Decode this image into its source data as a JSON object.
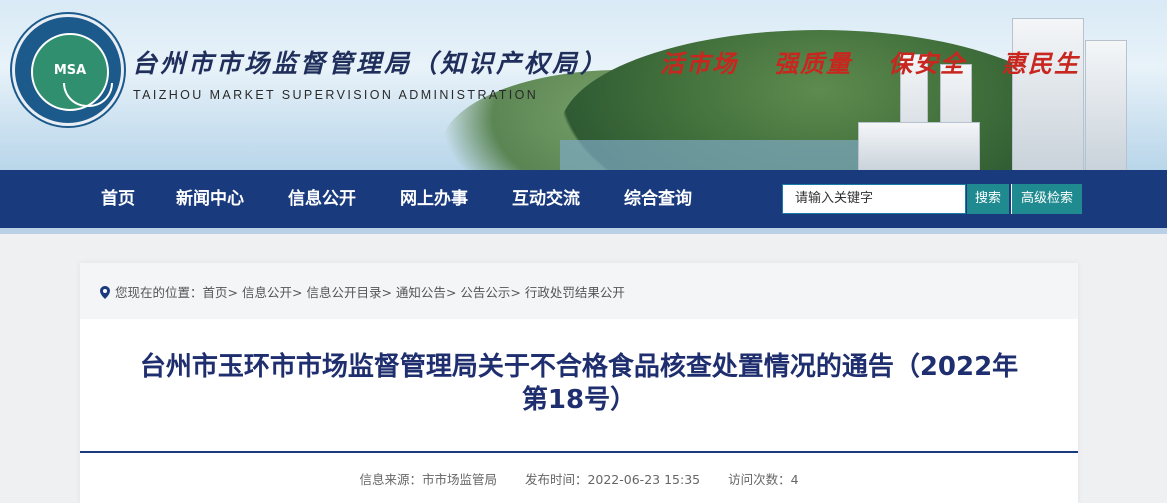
{
  "header": {
    "logo_text": "MSA",
    "logo_ring_text": "TAIZHOU MARKET SUPERVISION ADMINISTRATION",
    "title": "台州市市场监督管理局（知识产权局）",
    "subtitle": "TAIZHOU MARKET SUPERVISION ADMINISTRATION",
    "slogans": [
      "活市场",
      "强质量",
      "保安全",
      "惠民生"
    ]
  },
  "nav": {
    "items": [
      "首页",
      "新闻中心",
      "信息公开",
      "网上办事",
      "互动交流",
      "综合查询"
    ],
    "search_placeholder": "请输入关键字",
    "search_button": "搜索",
    "advanced_button": "高级检索"
  },
  "breadcrumb": {
    "prefix": "您现在的位置：",
    "path": [
      "首页",
      "信息公开",
      "信息公开目录",
      "通知公告",
      "公告公示",
      "行政处罚结果公开"
    ]
  },
  "article": {
    "title_line1": "台州市玉环市市场监督管理局关于不合格食品核查处置情况的通告（2022年",
    "title_line2": "第18号）",
    "source": "信息来源：市市场监管局",
    "published": "发布时间：2022-06-23 15:35",
    "views": "访问次数：4"
  },
  "colors": {
    "nav_bg": "#1a3a7e",
    "slogan": "#c8271f",
    "title": "#1f2e6e",
    "button": "#1f8a8f"
  }
}
